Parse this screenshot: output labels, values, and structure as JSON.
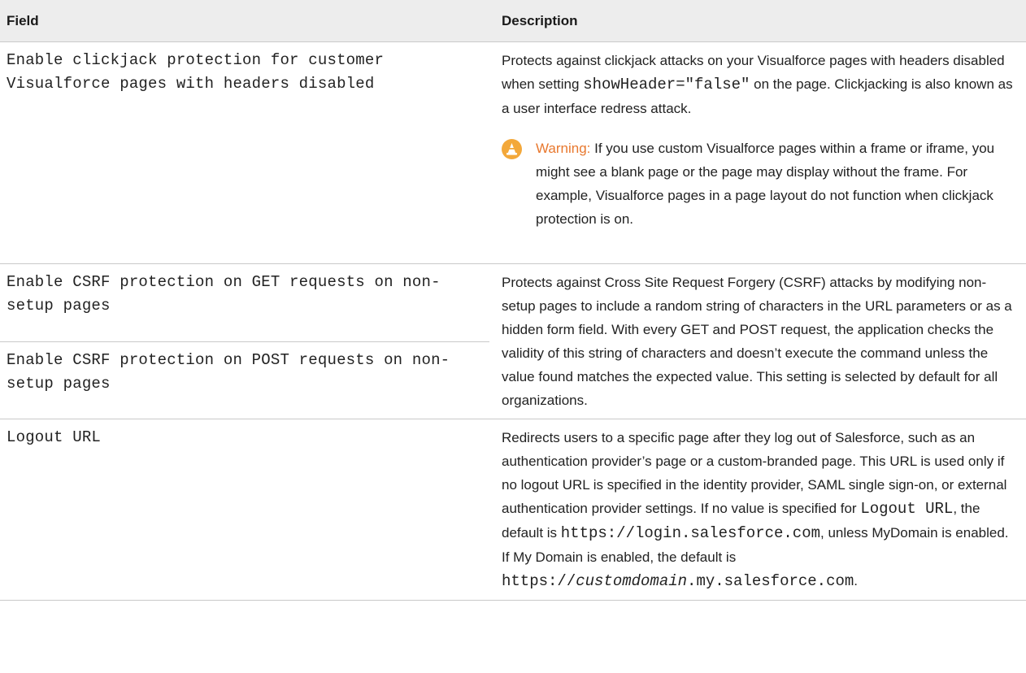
{
  "table": {
    "headers": {
      "field": "Field",
      "description": "Description"
    },
    "rows": [
      {
        "field": "Enable clickjack protection for customer Visualforce pages with headers disabled",
        "description_before": "Protects against clickjack attacks on your Visualforce pages with headers disabled when setting ",
        "description_code": "showHeader=\"false\"",
        "description_after": " on the page. Clickjacking is also known as a user interface redress attack.",
        "warning_label": "Warning:",
        "warning_text": " If you use custom Visualforce pages within a frame or iframe, you might see a blank page or the page may display without the frame. For example, Visualforce pages in a page layout do not function when clickjack protection is on."
      },
      {
        "field": "Enable CSRF protection on GET requests on non-setup pages",
        "field2": "Enable CSRF protection on POST requests on non-setup pages",
        "description": "Protects against Cross Site Request Forgery (CSRF) attacks by modifying non-setup pages to include a random string of characters in the URL parameters or as a hidden form field. With every GET and POST request, the application checks the validity of this string of characters and doesn’t execute the command unless the value found matches the expected value. This setting is selected by default for all organizations."
      },
      {
        "field": "Logout URL",
        "d1": "Redirects users to a specific page after they log out of Salesforce, such as an authentication provider’s page or a custom-branded page. This URL is used only if no logout URL is specified in the identity provider, SAML single sign-on, or external authentication provider settings. If no value is specified for ",
        "d1_code": "Logout URL",
        "d2": ", the default is ",
        "d2_code": "https://login.salesforce.com",
        "d3": ", unless MyDomain is enabled. If My Domain is enabled, the default is ",
        "d4_code_prefix": "https://",
        "d4_code_italic": "customdomain",
        "d4_code_suffix": ".my.salesforce.com",
        "d5": "."
      }
    ]
  },
  "icons": {
    "warning": "warning-cone-icon"
  },
  "colors": {
    "warning": "#e8782e",
    "header_bg": "#ededed",
    "rule": "#c9c9c9"
  }
}
